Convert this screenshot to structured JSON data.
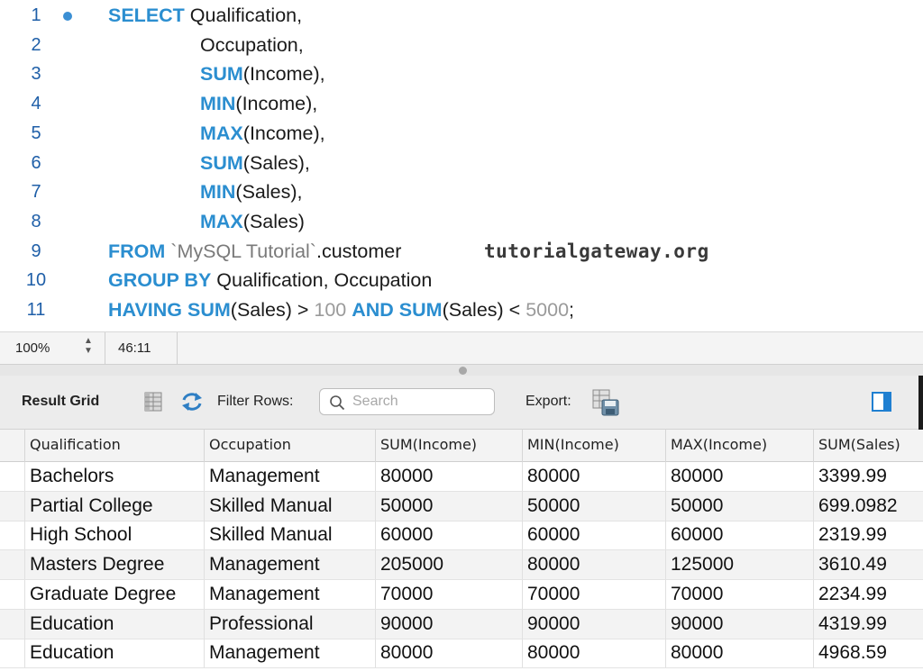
{
  "editor": {
    "lines": [
      {
        "num": "1",
        "breakpoint": true,
        "indent": false,
        "tokens": [
          {
            "t": "kw",
            "v": "SELECT"
          },
          {
            "t": "txt",
            "v": " Qualification,"
          }
        ]
      },
      {
        "num": "2",
        "breakpoint": false,
        "indent": true,
        "tokens": [
          {
            "t": "txt",
            "v": "Occupation,"
          }
        ]
      },
      {
        "num": "3",
        "breakpoint": false,
        "indent": true,
        "tokens": [
          {
            "t": "kw",
            "v": "SUM"
          },
          {
            "t": "txt",
            "v": "(Income),"
          }
        ]
      },
      {
        "num": "4",
        "breakpoint": false,
        "indent": true,
        "tokens": [
          {
            "t": "kw",
            "v": "MIN"
          },
          {
            "t": "txt",
            "v": "(Income),"
          }
        ]
      },
      {
        "num": "5",
        "breakpoint": false,
        "indent": true,
        "tokens": [
          {
            "t": "kw",
            "v": "MAX"
          },
          {
            "t": "txt",
            "v": "(Income),"
          }
        ]
      },
      {
        "num": "6",
        "breakpoint": false,
        "indent": true,
        "tokens": [
          {
            "t": "kw",
            "v": "SUM"
          },
          {
            "t": "txt",
            "v": "(Sales),"
          }
        ]
      },
      {
        "num": "7",
        "breakpoint": false,
        "indent": true,
        "tokens": [
          {
            "t": "kw",
            "v": "MIN"
          },
          {
            "t": "txt",
            "v": "(Sales),"
          }
        ]
      },
      {
        "num": "8",
        "breakpoint": false,
        "indent": true,
        "tokens": [
          {
            "t": "kw",
            "v": "MAX"
          },
          {
            "t": "txt",
            "v": "(Sales)"
          }
        ]
      },
      {
        "num": "9",
        "breakpoint": false,
        "indent": false,
        "tokens": [
          {
            "t": "kw",
            "v": "FROM"
          },
          {
            "t": "txt",
            "v": " "
          },
          {
            "t": "str",
            "v": "`MySQL Tutorial`"
          },
          {
            "t": "txt",
            "v": ".customer"
          }
        ]
      },
      {
        "num": "10",
        "breakpoint": false,
        "indent": false,
        "tokens": [
          {
            "t": "kw",
            "v": "GROUP BY"
          },
          {
            "t": "txt",
            "v": " Qualification, Occupation"
          }
        ]
      },
      {
        "num": "11",
        "breakpoint": false,
        "indent": false,
        "tokens": [
          {
            "t": "kw",
            "v": "HAVING SUM"
          },
          {
            "t": "txt",
            "v": "(Sales) > "
          },
          {
            "t": "num",
            "v": "100"
          },
          {
            "t": "txt",
            "v": " "
          },
          {
            "t": "kw",
            "v": "AND SUM"
          },
          {
            "t": "txt",
            "v": "(Sales) < "
          },
          {
            "t": "num",
            "v": "5000"
          },
          {
            "t": "txt",
            "v": ";"
          }
        ]
      }
    ],
    "watermark": "tutorialgateway.org"
  },
  "statusbar": {
    "zoom": "100%",
    "cursor_position": "46:11"
  },
  "toolbar": {
    "result_grid_label": "Result Grid",
    "filter_rows_label": "Filter Rows:",
    "search_placeholder": "Search",
    "export_label": "Export:"
  },
  "grid": {
    "columns": [
      "Qualification",
      "Occupation",
      "SUM(Income)",
      "MIN(Income)",
      "MAX(Income)",
      "SUM(Sales)"
    ],
    "rows": [
      [
        "Bachelors",
        "Management",
        "80000",
        "80000",
        "80000",
        "3399.99"
      ],
      [
        "Partial College",
        "Skilled Manual",
        "50000",
        "50000",
        "50000",
        "699.0982"
      ],
      [
        "High School",
        "Skilled Manual",
        "60000",
        "60000",
        "60000",
        "2319.99"
      ],
      [
        "Masters Degree",
        "Management",
        "205000",
        "80000",
        "125000",
        "3610.49"
      ],
      [
        "Graduate Degree",
        "Management",
        "70000",
        "70000",
        "70000",
        "2234.99"
      ],
      [
        "Education",
        "Professional",
        "90000",
        "90000",
        "90000",
        "4319.99"
      ],
      [
        "Education",
        "Management",
        "80000",
        "80000",
        "80000",
        "4968.59"
      ]
    ]
  },
  "colors": {
    "keyword": "#2b8ed0",
    "line_number": "#1f5fa8",
    "literal": "#9a9a9a"
  }
}
